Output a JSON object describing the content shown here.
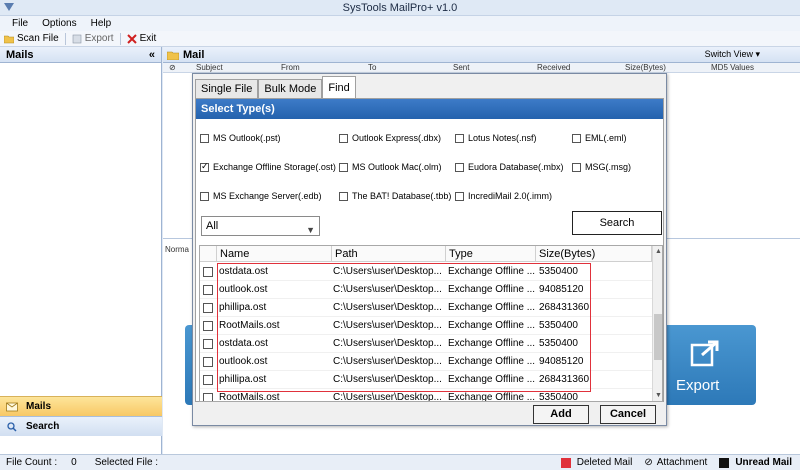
{
  "app": {
    "title": "SysTools MailPro+ v1.0"
  },
  "menu": [
    "File",
    "Options",
    "Help"
  ],
  "toolbar": {
    "scan_label": "Scan File",
    "export_label": "Export",
    "exit_label": "Exit"
  },
  "left_pane": {
    "header": "Mails",
    "collapse": "«",
    "nav_mails": "Mails",
    "nav_search": "Search"
  },
  "mail_pane": {
    "header": "Mail",
    "switch_view": "Switch View ▾",
    "columns": [
      "Subject",
      "From",
      "To",
      "Sent",
      "Received",
      "Size(Bytes)",
      "MD5 Values"
    ],
    "normal_tab": "Norma",
    "export_label": "Export"
  },
  "status": {
    "file_count_label": "File Count :",
    "file_count_value": "0",
    "selected_label": "Selected File :",
    "deleted": "Deleted Mail",
    "attachment": "Attachment",
    "unread": "Unread Mail"
  },
  "dialog": {
    "tabs": [
      "Single File",
      "Bulk Mode",
      "Find"
    ],
    "active_tab": "Find",
    "select_header": "Select Type(s)",
    "types": [
      {
        "label": "MS Outlook(.pst)",
        "checked": false
      },
      {
        "label": "Outlook Express(.dbx)",
        "checked": false
      },
      {
        "label": "Lotus Notes(.nsf)",
        "checked": false
      },
      {
        "label": "EML(.eml)",
        "checked": false
      },
      {
        "label": "Exchange Offline Storage(.ost)",
        "checked": true
      },
      {
        "label": "MS Outlook Mac(.olm)",
        "checked": false
      },
      {
        "label": "Eudora Database(.mbx)",
        "checked": false
      },
      {
        "label": "MSG(.msg)",
        "checked": false
      },
      {
        "label": "MS Exchange Server(.edb)",
        "checked": false
      },
      {
        "label": "The BAT! Database(.tbb)",
        "checked": false
      },
      {
        "label": "IncrediMail 2.0(.imm)",
        "checked": false
      }
    ],
    "drive_select": "All",
    "search_label": "Search",
    "grid_headers": [
      "Name",
      "Path",
      "Type",
      "Size(Bytes)"
    ],
    "rows": [
      {
        "name": "ostdata.ost",
        "path": "C:\\Users\\user\\Desktop...",
        "type": "Exchange Offline ...",
        "size": "5350400"
      },
      {
        "name": "outlook.ost",
        "path": "C:\\Users\\user\\Desktop...",
        "type": "Exchange Offline ...",
        "size": "94085120"
      },
      {
        "name": "phillipa.ost",
        "path": "C:\\Users\\user\\Desktop...",
        "type": "Exchange Offline ...",
        "size": "268431360"
      },
      {
        "name": "RootMails.ost",
        "path": "C:\\Users\\user\\Desktop...",
        "type": "Exchange Offline ...",
        "size": "5350400"
      },
      {
        "name": "ostdata.ost",
        "path": "C:\\Users\\user\\Desktop...",
        "type": "Exchange Offline ...",
        "size": "5350400"
      },
      {
        "name": "outlook.ost",
        "path": "C:\\Users\\user\\Desktop...",
        "type": "Exchange Offline ...",
        "size": "94085120"
      },
      {
        "name": "phillipa.ost",
        "path": "C:\\Users\\user\\Desktop...",
        "type": "Exchange Offline ...",
        "size": "268431360"
      },
      {
        "name": "RootMails.ost",
        "path": "C:\\Users\\user\\Desktop...",
        "type": "Exchange Offline ...",
        "size": "5350400"
      }
    ],
    "add_label": "Add",
    "cancel_label": "Cancel"
  },
  "colors": {
    "accent": "#2462ad",
    "deleted": "#e0313b",
    "highlight": "#e0313b"
  }
}
